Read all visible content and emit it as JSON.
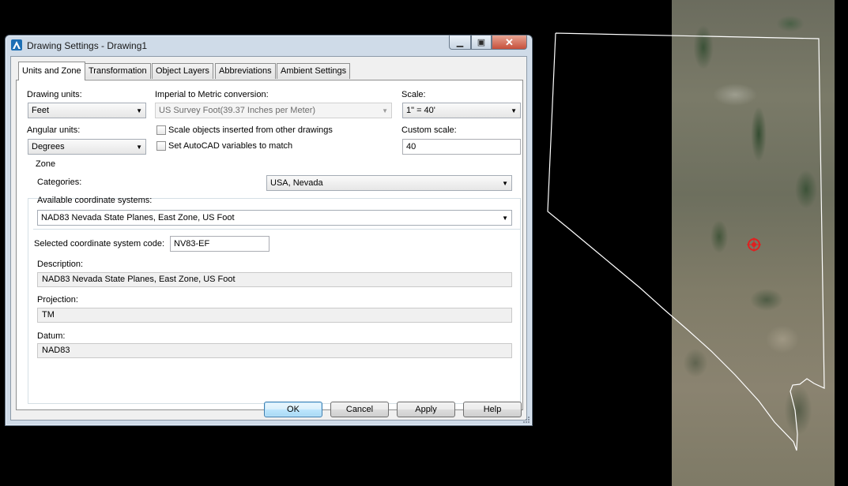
{
  "window": {
    "title": "Drawing Settings - Drawing1",
    "controls": {
      "minimize": "▁",
      "maximize": "▣",
      "close": "✕"
    }
  },
  "tabs": [
    {
      "label": "Units and Zone",
      "active": true
    },
    {
      "label": "Transformation",
      "active": false
    },
    {
      "label": "Object Layers",
      "active": false
    },
    {
      "label": "Abbreviations",
      "active": false
    },
    {
      "label": "Ambient Settings",
      "active": false
    }
  ],
  "units": {
    "drawing_units_label": "Drawing units:",
    "drawing_units_value": "Feet",
    "angular_units_label": "Angular units:",
    "angular_units_value": "Degrees",
    "imperial_label": "Imperial to Metric conversion:",
    "imperial_value": "US Survey Foot(39.37 Inches per Meter)",
    "scale_objects_label": "Scale objects inserted from other drawings",
    "set_autocad_label": "Set AutoCAD variables to match",
    "scale_label": "Scale:",
    "scale_value": "1\" = 40'",
    "custom_scale_label": "Custom scale:",
    "custom_scale_value": "40"
  },
  "zone": {
    "group_label": "Zone",
    "categories_label": "Categories:",
    "categories_value": "USA, Nevada",
    "available_label": "Available coordinate systems:",
    "available_value": "NAD83 Nevada State Planes, East Zone, US Foot",
    "selected_code_label": "Selected coordinate system code:",
    "selected_code_value": "NV83-EF",
    "description_label": "Description:",
    "description_value": "NAD83 Nevada State Planes, East Zone, US Foot",
    "projection_label": "Projection:",
    "projection_value": "TM",
    "datum_label": "Datum:",
    "datum_value": "NAD83"
  },
  "buttons": {
    "ok": "OK",
    "cancel": "Cancel",
    "apply": "Apply",
    "help": "Help"
  },
  "colors": {
    "accent": "#3c7fb1",
    "close_button": "#c6503b",
    "map_marker": "#e02020",
    "boundary_line": "#ffffff"
  },
  "icons": [
    "autocad-app-icon",
    "dropdown-caret-icon",
    "crosshair-marker-icon",
    "resize-grip-icon"
  ]
}
